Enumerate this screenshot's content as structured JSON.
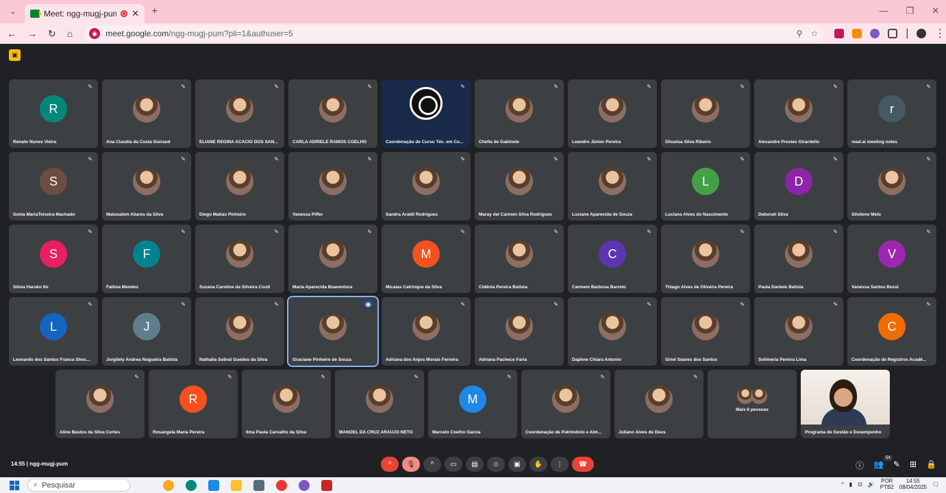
{
  "browser": {
    "tab_title": "Meet: ngg-mugj-pum",
    "url_host": "meet.google.com",
    "url_path": "/ngg-mugj-pum?pli=1&authuser=5"
  },
  "meeting": {
    "time": "14:55",
    "code": "ngg-mugj-pum",
    "participant_badge": "54"
  },
  "rows": [
    [
      {
        "name": "Renato Nunes Vieira",
        "type": "letter",
        "letter": "R",
        "color": "#00897b"
      },
      {
        "name": "Ana Claudia da Costa Guiraud",
        "type": "photo"
      },
      {
        "name": "ELIANE REGINA ACACIO DOS SAN...",
        "type": "photo"
      },
      {
        "name": "CARLA ADRIELE RAMOS COELHO",
        "type": "photo"
      },
      {
        "name": "Coordenação de Curso Téc. em Co...",
        "type": "obs"
      },
      {
        "name": "Chefia de Gabinete",
        "type": "photo"
      },
      {
        "name": "Leandro Júnior Pereira",
        "type": "photo"
      },
      {
        "name": "Ghuelsa Silva Ribeiro",
        "type": "photo"
      },
      {
        "name": "Alexandre Prestes Girardello",
        "type": "photo"
      },
      {
        "name": "read.ai meeting notes",
        "type": "letter",
        "letter": "r",
        "color": "#455a64"
      }
    ],
    [
      {
        "name": "Sonia MariaTeixeira Machado",
        "type": "letter",
        "letter": "S",
        "color": "#6d4c41"
      },
      {
        "name": "Matusalem Aliares da Silva",
        "type": "photo"
      },
      {
        "name": "Diego Matias Pinheiro",
        "type": "photo"
      },
      {
        "name": "Vanessa Piffer",
        "type": "photo"
      },
      {
        "name": "Sandra Araldi Rodrigues",
        "type": "photo"
      },
      {
        "name": "Maray del Carmen Silva Rodrigues",
        "type": "photo"
      },
      {
        "name": "Luciane Aparecida de Souza",
        "type": "photo"
      },
      {
        "name": "Luciana Alves do Nascimento",
        "type": "letter",
        "letter": "L",
        "color": "#43a047"
      },
      {
        "name": "Deborah Silva",
        "type": "letter",
        "letter": "D",
        "color": "#8e24aa"
      },
      {
        "name": "Silvilene Melo",
        "type": "photo"
      }
    ],
    [
      {
        "name": "Sônia Haruko Ito",
        "type": "letter",
        "letter": "S",
        "color": "#e91e63"
      },
      {
        "name": "Fatima Mendes",
        "type": "letter",
        "letter": "F",
        "color": "#00838f"
      },
      {
        "name": "Suzana Caroline da Silveira Couti",
        "type": "photo"
      },
      {
        "name": "Maria Aparecida Boaventura",
        "type": "photo"
      },
      {
        "name": "Micaias Catrinque da Silva",
        "type": "letter",
        "letter": "M",
        "color": "#f4511e"
      },
      {
        "name": "Cidênia Pereira Batista",
        "type": "photo"
      },
      {
        "name": "Carmem Barbosa Barreto",
        "type": "letter",
        "letter": "C",
        "color": "#5e35b1"
      },
      {
        "name": "Thiago Alves de Oliveira Pereira",
        "type": "photo"
      },
      {
        "name": "Paula Daniele Batista",
        "type": "photo"
      },
      {
        "name": "Vanessa Santos Bessi",
        "type": "letter",
        "letter": "V",
        "color": "#9c27b0"
      }
    ],
    [
      {
        "name": "Leonardo dos Santos Franca Shoc...",
        "type": "letter",
        "letter": "L",
        "color": "#1565c0"
      },
      {
        "name": "Jorgilely Andrea Nogueira Batista",
        "type": "letter",
        "letter": "J",
        "color": "#607d8b"
      },
      {
        "name": "Nathalia Sobral Guedes da Silva",
        "type": "photo"
      },
      {
        "name": "Graciane Pinheiro de Souza",
        "type": "photo",
        "speaking": true
      },
      {
        "name": "Adriana dos Anjos Morais Ferreira",
        "type": "photo"
      },
      {
        "name": "Adriana Pacheco Faria",
        "type": "photo"
      },
      {
        "name": "Daphne Chiara Antonio",
        "type": "photo"
      },
      {
        "name": "Siriel Soares dos Santos",
        "type": "photo"
      },
      {
        "name": "Solimeria Pereira Lima",
        "type": "photo"
      },
      {
        "name": "Coordenação de Registros Acadê...",
        "type": "letter",
        "letter": "C",
        "color": "#ef6c00"
      }
    ],
    [
      {
        "name": "Aline Bastos da Silva Cortes",
        "type": "photo"
      },
      {
        "name": "Rosangela Maria Pereira",
        "type": "letter",
        "letter": "R",
        "color": "#f4511e"
      },
      {
        "name": "Ilma Paula Carvalho da Silva",
        "type": "photo"
      },
      {
        "name": "MANOEL DA CRUZ ARAUJO NETO",
        "type": "photo"
      },
      {
        "name": "Marcelo Coelho Garcia",
        "type": "letter",
        "letter": "M",
        "color": "#1e88e5"
      },
      {
        "name": "Coordenação de Patrimônio e Alm...",
        "type": "photo"
      },
      {
        "name": "Juliano Alves de Deus",
        "type": "photo"
      },
      {
        "name": "Mais 6 pessoas",
        "type": "more"
      },
      {
        "name": "Programa de Gestão e Desempenho",
        "type": "presenter"
      }
    ]
  ],
  "taskbar": {
    "search_placeholder": "Pesquisar",
    "lang_top": "POR",
    "lang_bottom": "PTB2",
    "clock_time": "14:55",
    "clock_date": "08/04/2025"
  },
  "colors": {
    "tile_bg": "#3c4043",
    "meet_bg": "#202124",
    "speaking_outline": "#8ab4f8",
    "end_call": "#ea4335"
  }
}
